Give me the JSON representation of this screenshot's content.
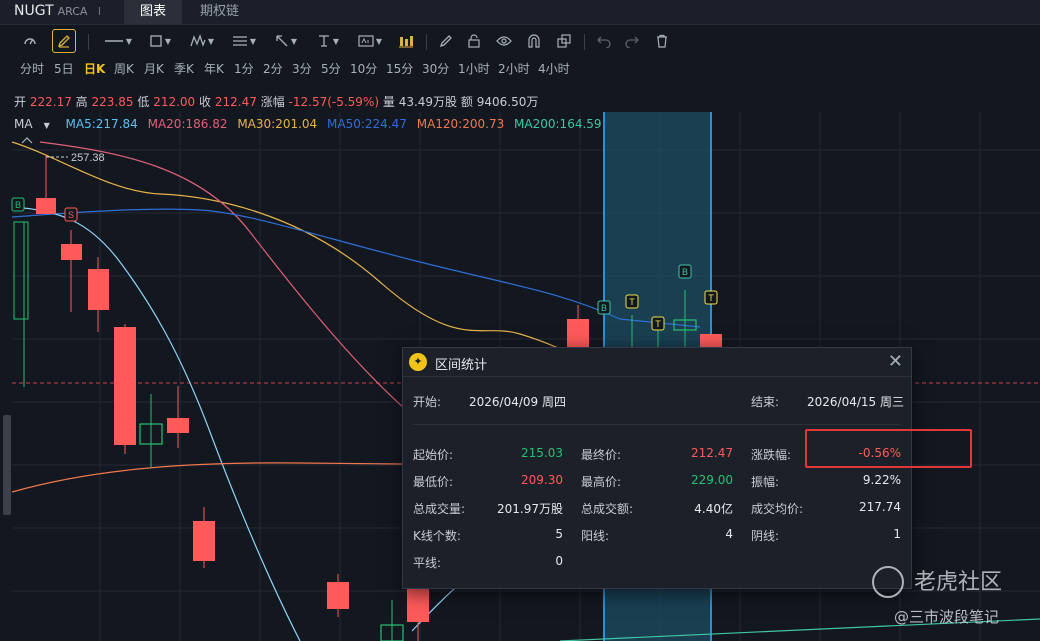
{
  "tabbar": {
    "ticker": "NUGT",
    "exchange": "ARCA",
    "divider": "I",
    "tabs": [
      {
        "label": "图表",
        "active": true
      },
      {
        "label": "期权链",
        "active": false
      }
    ]
  },
  "toolbar": {
    "icons": [
      "cursor-icon",
      "draw-pen-icon",
      "line-icon",
      "rect-icon",
      "wave-icon",
      "fib-icon",
      "arrow-icon",
      "text-icon",
      "label-icon",
      "bar-indicator-icon",
      "eraser-icon",
      "lock-icon",
      "eye-icon",
      "magnet-icon",
      "layers-icon",
      "undo-icon",
      "redo-icon",
      "trash-icon"
    ]
  },
  "periods": [
    "分时",
    "5日",
    "日K",
    "周K",
    "月K",
    "季K",
    "年K",
    "1分",
    "2分",
    "3分",
    "5分",
    "10分",
    "15分",
    "30分",
    "1小时",
    "2小时",
    "4小时"
  ],
  "active_period": "日K",
  "quote": {
    "open_label": "开",
    "open": "222.17",
    "high_label": "高",
    "high": "223.85",
    "low_label": "低",
    "low": "212.00",
    "close_label": "收",
    "close": "212.47",
    "change_label": "涨幅",
    "change": "-12.57(-5.59%)",
    "volume_label": "量",
    "volume": "43.49万股",
    "amount_label": "额",
    "amount": "9406.50万"
  },
  "ma": {
    "label": "MA",
    "items": [
      {
        "text": "MA5:217.84",
        "color": "#5bc0f5"
      },
      {
        "text": "MA20:186.82",
        "color": "#e0607a"
      },
      {
        "text": "MA30:201.04",
        "color": "#e6b34a"
      },
      {
        "text": "MA50:224.47",
        "color": "#2f6fd6"
      },
      {
        "text": "MA120:200.73",
        "color": "#f07850"
      },
      {
        "text": "MA200:164.59",
        "color": "#3fc6a4"
      }
    ]
  },
  "chart": {
    "max_marker": "257.38",
    "trade_marks": {
      "buy": "B",
      "sell": "S",
      "t": "T"
    }
  },
  "popup": {
    "title": "区间统计",
    "start_label": "开始:",
    "start": "2026/04/09 周四",
    "end_label": "结束:",
    "end": "2026/04/15 周三",
    "rows": [
      [
        {
          "k": "起始价:",
          "v": "215.03",
          "c": "#25c274"
        },
        {
          "k": "最终价:",
          "v": "212.47",
          "c": "#ff5a5a"
        },
        {
          "k": "涨跌幅:",
          "v": "-0.56%",
          "c": "#ff5a5a"
        }
      ],
      [
        {
          "k": "最低价:",
          "v": "209.30",
          "c": "#ff5a5a"
        },
        {
          "k": "最高价:",
          "v": "229.00",
          "c": "#25c274"
        },
        {
          "k": "振幅:",
          "v": "9.22%",
          "c": "#e6e8ec"
        }
      ],
      [
        {
          "k": "总成交量:",
          "v": "201.97万股",
          "c": "#e6e8ec"
        },
        {
          "k": "总成交额:",
          "v": "4.40亿",
          "c": "#e6e8ec"
        },
        {
          "k": "成交均价:",
          "v": "217.74",
          "c": "#e6e8ec"
        }
      ],
      [
        {
          "k": "K线个数:",
          "v": "5",
          "c": "#e6e8ec"
        },
        {
          "k": "阳线:",
          "v": "4",
          "c": "#e6e8ec"
        },
        {
          "k": "阴线:",
          "v": "1",
          "c": "#e6e8ec"
        }
      ],
      [
        {
          "k": "平线:",
          "v": "0",
          "c": "#e6e8ec"
        }
      ]
    ]
  },
  "watermark": {
    "brand": "老虎社区",
    "author": "@三市波段笔记"
  },
  "colors": {
    "up": "#25c274",
    "down": "#ff5a5a",
    "highlight": "#e03838",
    "selection": "#2f8fd6"
  }
}
